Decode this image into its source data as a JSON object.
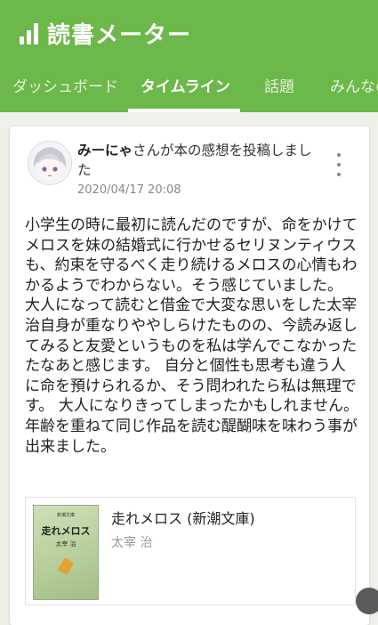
{
  "app": {
    "title": "読書メーター",
    "tabs": [
      {
        "label": "ダッシュボード",
        "active": false
      },
      {
        "label": "タイムライン",
        "active": true
      },
      {
        "label": "話題",
        "active": false
      },
      {
        "label": "みんなの",
        "active": false
      }
    ],
    "brand_color": "#6cb84a"
  },
  "post": {
    "user": "みーにゃ",
    "action": "さんが本の感想を投稿しました",
    "date": "2020/04/17 20:08",
    "review": "小学生の時に最初に読んだのですが、命をかけてメロスを妹の結婚式に行かせるセリヌンティウスも、約束を守るべく走り続けるメロスの心情もわかるようでわからない。そう感じていました。 大人になって読むと借金で大変な思いをした太宰治自身が重なりややしらけたものの、今読み返してみると友愛というものを私は学んでこなかったたなあと感じます。 自分と個性も思考も違う人に命を預けられるか、そう問われたら私は無理です。 大人になりきってしまったかもしれません。 年齢を重ねて同じ作品を読む醍醐味を味わう事が出来ました。"
  },
  "book": {
    "title": "走れメロス (新潮文庫)",
    "author": "太宰 治",
    "cover": {
      "series": "新潮文庫",
      "title": "走れメロス",
      "author": "太宰 治"
    }
  }
}
